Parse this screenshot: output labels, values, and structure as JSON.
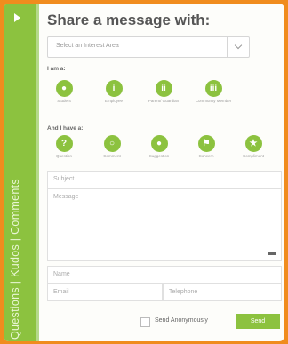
{
  "side_tab": {
    "label": "Questions | Kudos | Comments"
  },
  "header": {
    "title": "Share a message with:"
  },
  "interest_select": {
    "selected": "Select an Interest Area"
  },
  "i_am": {
    "label": "I am a:",
    "options": [
      {
        "label": "Student",
        "icon": "student-icon"
      },
      {
        "label": "Employee",
        "icon": "employee-icon"
      },
      {
        "label": "Parent/ Guardian",
        "icon": "parent-guardian-icon"
      },
      {
        "label": "Community Member",
        "icon": "community-member-icon"
      }
    ]
  },
  "i_have": {
    "label": "And I have a:",
    "options": [
      {
        "label": "Question",
        "icon": "question-icon"
      },
      {
        "label": "Comment",
        "icon": "comment-icon"
      },
      {
        "label": "Suggestion",
        "icon": "suggestion-icon"
      },
      {
        "label": "Concern",
        "icon": "concern-flag-icon"
      },
      {
        "label": "Compliment",
        "icon": "compliment-star-icon"
      }
    ]
  },
  "form": {
    "subject_placeholder": "Subject",
    "message_placeholder": "Message",
    "name_placeholder": "Name",
    "email_placeholder": "Email",
    "telephone_placeholder": "Telephone"
  },
  "footer": {
    "anonymous_label": "Send Anonymously",
    "send_label": "Send"
  },
  "colors": {
    "accent": "#8cc23f",
    "outer": "#f08c1e"
  }
}
